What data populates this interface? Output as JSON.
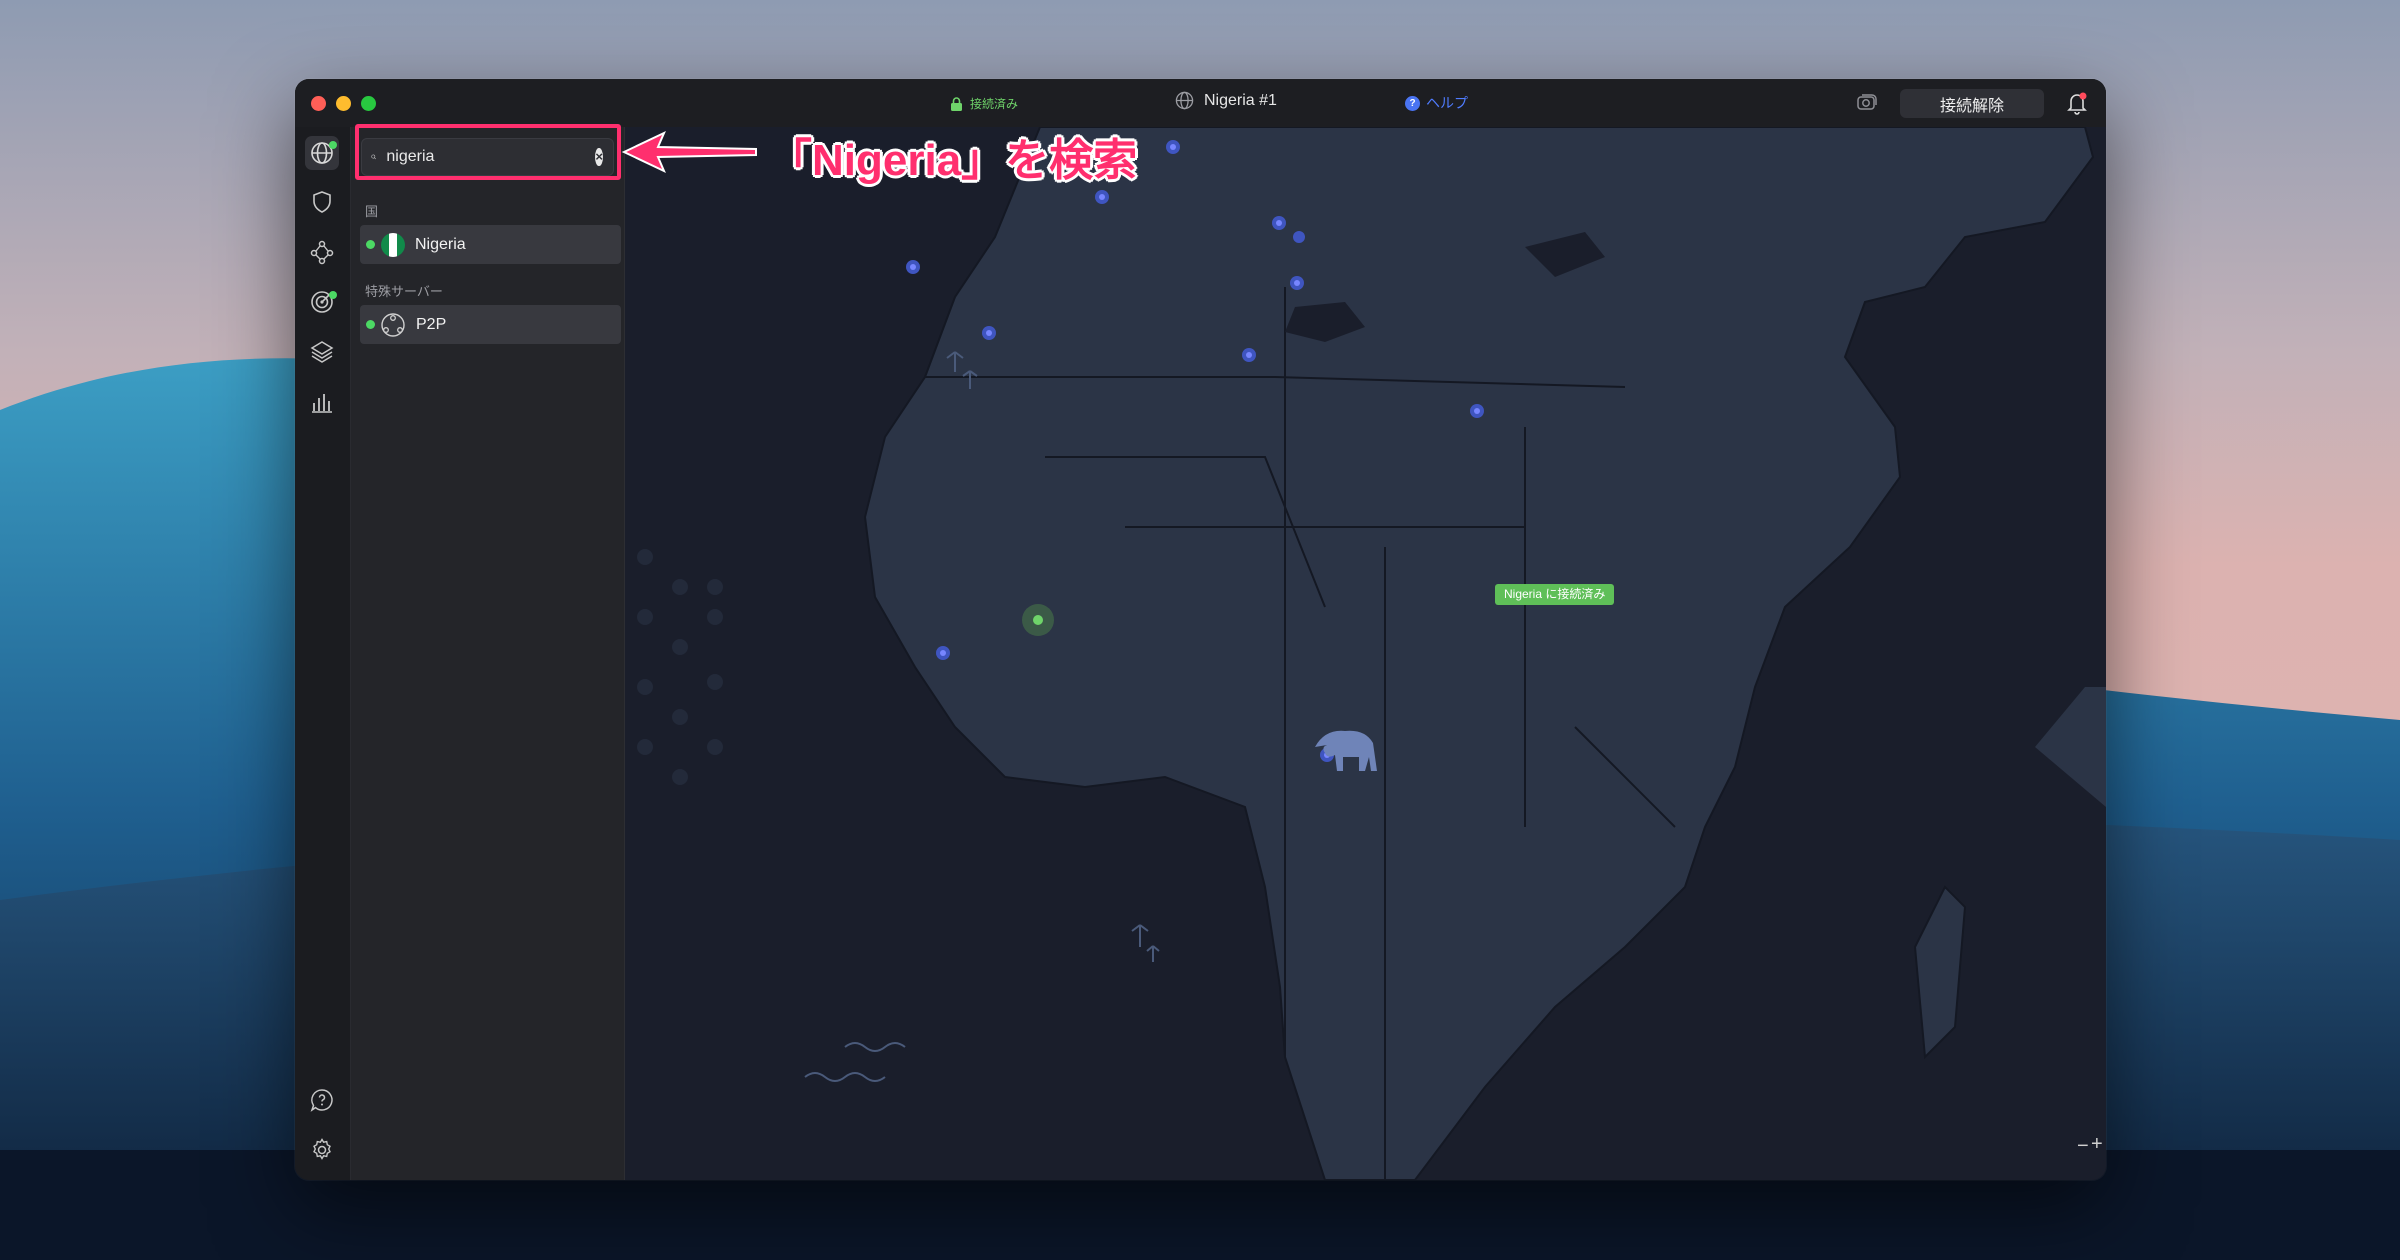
{
  "titlebar": {
    "status": "接続済み",
    "server": "Nigeria #1",
    "help": "ヘルプ",
    "help_badge": "?",
    "disconnect": "接続解除"
  },
  "search": {
    "value": "nigeria",
    "placeholder": "nigeria",
    "clear_glyph": "×"
  },
  "results": {
    "countries_header": "国",
    "country": "Nigeria",
    "special_header": "特殊サーバー",
    "special": "P2P"
  },
  "map": {
    "connected_label": "Nigeria に接続済み",
    "zoom_out": "−",
    "zoom_in": "+"
  },
  "annotation": {
    "text": "「Nigeria」を検索"
  },
  "colors": {
    "accent_green": "#4cd964",
    "help_blue": "#4f7cff",
    "highlight_pink": "#ff2f6e",
    "map_land": "#2b3446",
    "map_sea": "#1a1e2b"
  },
  "icons": {
    "rail": [
      "globe-icon",
      "shield-icon",
      "meshnet-icon",
      "threat-radar-icon",
      "layers-icon",
      "stats-icon",
      "help-chat-icon",
      "settings-icon"
    ]
  }
}
